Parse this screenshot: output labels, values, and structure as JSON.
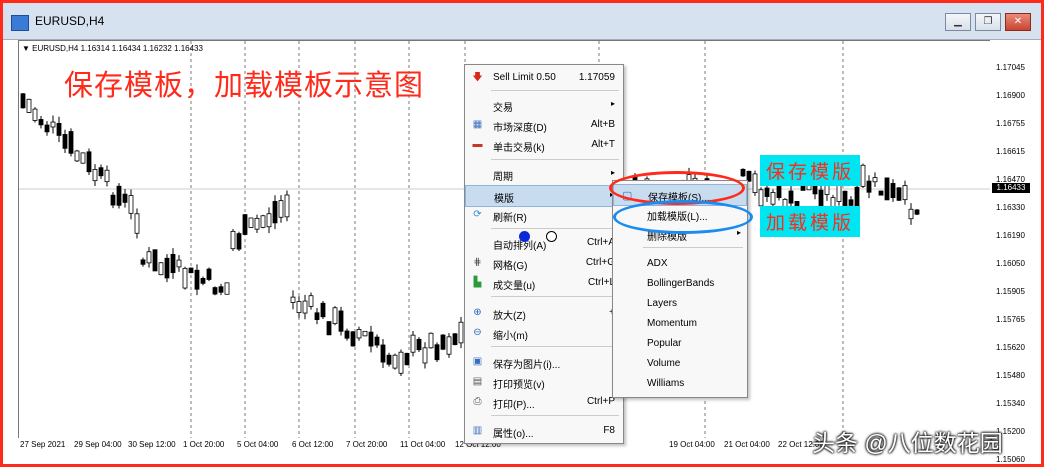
{
  "window": {
    "title": "EURUSD,H4"
  },
  "chart": {
    "symbol_info": "EURUSD,H4  1.16314 1.16434 1.16232 1.16433",
    "current_price": "1.16433",
    "price_ticks": [
      "1.17045",
      "1.16900",
      "1.16755",
      "1.16615",
      "1.16470",
      "1.16330",
      "1.16190",
      "1.16050",
      "1.15905",
      "1.15765",
      "1.15620",
      "1.15480",
      "1.15340",
      "1.15200",
      "1.15060"
    ],
    "time_ticks": [
      "27 Sep 2021",
      "29 Sep 04:00",
      "30 Sep 12:00",
      "1 Oct 20:00",
      "5 Oct 04:00",
      "6 Oct 12:00",
      "7 Oct 20:00",
      "11 Oct 04:00",
      "12 Oct 12:00",
      "19 Oct 04:00",
      "21 Oct 04:00",
      "22 Oct 12:00"
    ]
  },
  "overlay": {
    "title": "保存模板，加载模板示意图",
    "save_note": "保存模版",
    "load_note": "加载模版"
  },
  "context_menu": {
    "items": [
      {
        "label": "Sell Limit 0.50",
        "shortcut": "1.17059",
        "icon": "sell-arrow-icon"
      },
      {
        "label": "交易",
        "shortcut": "",
        "submenu": true
      },
      {
        "label": "市场深度(D)",
        "shortcut": "Alt+B",
        "icon": "depth-icon"
      },
      {
        "label": "单击交易(k)",
        "shortcut": "Alt+T",
        "icon": "one-click-icon"
      },
      {
        "label": "周期",
        "shortcut": "",
        "submenu": true
      },
      {
        "label": "模版",
        "shortcut": "",
        "submenu": true
      },
      {
        "label": "刷新(R)",
        "shortcut": "",
        "icon": "refresh-icon"
      },
      {
        "label": "自动排列(A)",
        "shortcut": "Ctrl+A"
      },
      {
        "label": "网格(G)",
        "shortcut": "Ctrl+G",
        "icon": "grid-icon"
      },
      {
        "label": "成交量(u)",
        "shortcut": "Ctrl+L",
        "icon": "volume-icon"
      },
      {
        "label": "放大(Z)",
        "shortcut": "+",
        "icon": "zoom-in-icon"
      },
      {
        "label": "缩小(m)",
        "shortcut": "-",
        "icon": "zoom-out-icon"
      },
      {
        "label": "保存为图片(i)...",
        "shortcut": "",
        "icon": "save-image-icon"
      },
      {
        "label": "打印预览(v)",
        "shortcut": "",
        "icon": "print-preview-icon"
      },
      {
        "label": "打印(P)...",
        "shortcut": "Ctrl+P",
        "icon": "print-icon"
      },
      {
        "label": "属性(o)...",
        "shortcut": "F8",
        "icon": "properties-icon"
      }
    ]
  },
  "template_submenu": {
    "items": [
      {
        "label": "保存模板(S)...",
        "icon": "save-template-icon"
      },
      {
        "label": "加载模版(L)..."
      },
      {
        "label": "删除模版",
        "submenu": true
      },
      {
        "label": "ADX"
      },
      {
        "label": "BollingerBands"
      },
      {
        "label": "Layers"
      },
      {
        "label": "Momentum"
      },
      {
        "label": "Popular"
      },
      {
        "label": "Volume"
      },
      {
        "label": "Williams"
      }
    ]
  },
  "watermark": "头条 @八位数花园",
  "colors": {
    "frame": "#ff2a1a",
    "annotation_bg": "#00e5f2",
    "annotation_text": "#ff2a1a",
    "highlight": "#c8dcf0"
  }
}
